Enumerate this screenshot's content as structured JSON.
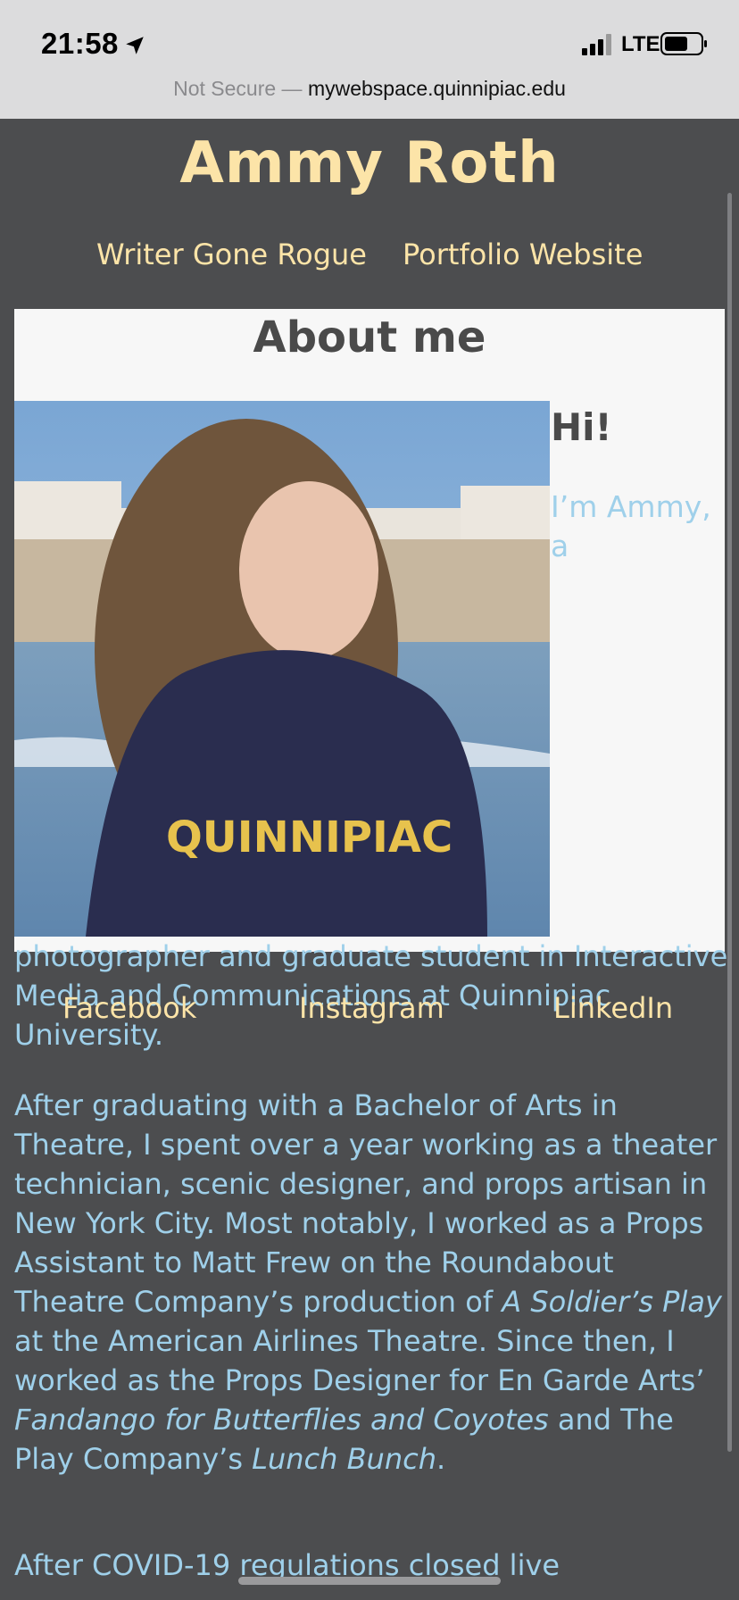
{
  "status_bar": {
    "time": "21:58",
    "network": "LTE",
    "icons": [
      "location-arrow-icon",
      "signal-bars-icon",
      "battery-icon"
    ]
  },
  "browser": {
    "url_prefix": "Not Secure —",
    "url_domain": "mywebspace.quinnipiac.edu"
  },
  "site": {
    "title": "Ammy Roth",
    "nav": [
      "Writer Gone Rogue",
      "Portfolio Website"
    ]
  },
  "about": {
    "heading": "About me",
    "greeting": "Hi!",
    "intro_start": "I’m Ammy, a",
    "photo_alt": "Quinnipiac"
  },
  "body": {
    "para1": "photographer and graduate student in Interactive Media and Communications at Quinnipiac University.",
    "para2_parts": [
      "After graduating with a Bachelor of Arts in Theatre, I spent over a year working as a theater technician, scenic designer, and props artisan in New York City. Most notably, I worked as a Props Assistant to Matt Frew on the Roundabout Theatre Company’s production of ",
      "A Soldier’s Play",
      " at the American Airlines Theatre. Since then, I worked as the Props Designer for En Garde Arts’ ",
      "Fandango for Butterflies and Coyotes",
      " and The Play Company’s ",
      "Lunch Bunch",
      "."
    ],
    "para3": "After COVID-19 regulations closed live"
  },
  "social": [
    "Facebook",
    "Instagram",
    "LinkedIn"
  ],
  "colors": {
    "page_bg": "#4c4d4f",
    "title": "#fce4a8",
    "body_text": "#9fd0ea",
    "panel_bg": "#f7f7f7"
  }
}
